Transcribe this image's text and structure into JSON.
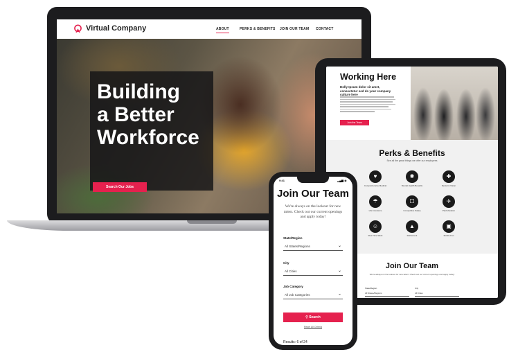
{
  "laptop": {
    "logo": "Virtual Company",
    "nav": [
      "ABOUT",
      "PERKS & BENEFITS",
      "JOIN OUR TEAM",
      "CONTACT"
    ],
    "hero_title": [
      "Building",
      "a Better",
      "Workforce"
    ],
    "hero_button": "Search Our Jobs"
  },
  "tablet": {
    "working_title": "Working Here",
    "working_subtitle": "Dolly Ipsum dolor sit amet, consectetur sed do your company culture here",
    "working_button": "Join the Team",
    "perks_title": "Perks & Benefits",
    "perks_subtitle": "See all the great things we offer our employees",
    "perks": [
      {
        "icon": "♥",
        "label": "Comprehensive Medical"
      },
      {
        "icon": "✱",
        "label": "Mental Health Benefits"
      },
      {
        "icon": "✚",
        "label": "Dental & Vision"
      },
      {
        "icon": "☂",
        "label": "Life Insurance"
      },
      {
        "icon": "☐",
        "label": "Competitive Salary"
      },
      {
        "icon": "✈",
        "label": "Paid Vacation"
      },
      {
        "icon": "☺",
        "label": "Flex Time Work"
      },
      {
        "icon": "▲",
        "label": "Retirement"
      },
      {
        "icon": "▣",
        "label": "Mobile Fun"
      }
    ],
    "join_title": "Join Our Team",
    "join_subtitle": "We're always on the lookout for new talent. Check out our current openings and apply today!",
    "fields": [
      {
        "label": "State/Region",
        "value": "All States/Regions"
      },
      {
        "label": "City",
        "value": "All Cities"
      }
    ]
  },
  "phone": {
    "time": "9:41",
    "status": "▂▄▆ ◉",
    "title": "Join Our Team",
    "description": "We're always on the lookout for new talent. Check out our current openings and apply today!",
    "filters": [
      {
        "label": "State/Region",
        "value": "All States/Regions"
      },
      {
        "label": "City",
        "value": "All Cities"
      },
      {
        "label": "Job Category",
        "value": "All Job Categories"
      }
    ],
    "search_button": "Search",
    "search_icon": "⚲",
    "reset": "Reset All Criteria",
    "results": "Results: 6 of 24"
  },
  "colors": {
    "accent": "#e5214e",
    "device": "#1c1c1e"
  }
}
